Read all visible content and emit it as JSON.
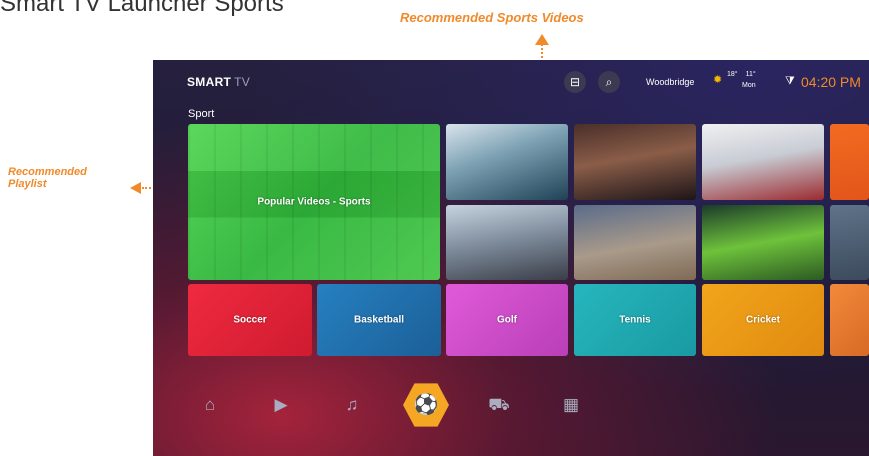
{
  "page_heading": "Smart TV Launcher Sports",
  "callouts": {
    "top": "Recommended Sports Videos",
    "left": "Recommended Playlist"
  },
  "header": {
    "brand": "SMART",
    "brand_suffix": "TV",
    "location": "Woodbridge",
    "temp_high": "18°",
    "temp_low": "11°",
    "day": "Mon",
    "time": "04:20 PM"
  },
  "section_title": "Sport",
  "playlist": {
    "label": "Popular Videos - Sports"
  },
  "categories": [
    {
      "label": "Soccer"
    },
    {
      "label": "Basketball"
    },
    {
      "label": "Golf"
    },
    {
      "label": "Tennis"
    },
    {
      "label": "Cricket"
    }
  ],
  "dock": [
    "home-icon",
    "video-icon",
    "music-icon",
    "sports-icon",
    "cart-icon",
    "apps-icon"
  ],
  "colors": {
    "accent": "#f08a2a",
    "active_dock": "#f5a623",
    "soccer": "#e8253c",
    "basketball": "#2478b8",
    "golf": "#d64fd0",
    "tennis": "#22b0b8",
    "cricket": "#f0a01a",
    "playlist": "#3cc83e"
  }
}
